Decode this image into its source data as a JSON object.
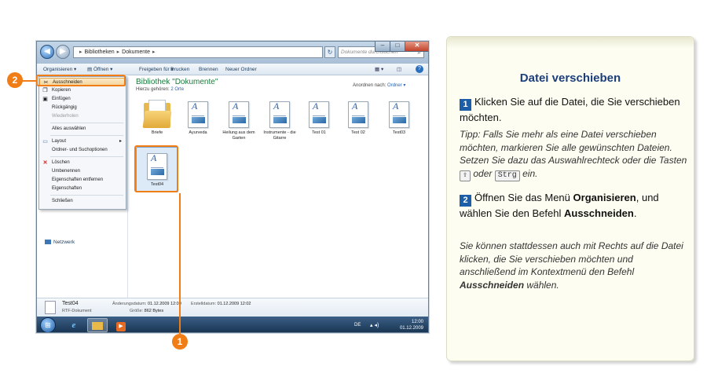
{
  "window": {
    "address": {
      "part1": "Bibliotheken",
      "part2": "Dokumente"
    },
    "search_placeholder": "Dokumente durchsuchen",
    "toolbar": {
      "organize": "Organisieren ▾",
      "open": "Öffnen ▾",
      "share": "Freigeben für ▾",
      "print": "Drucken",
      "burn": "Brennen",
      "new_folder": "Neuer Ordner"
    },
    "menu": {
      "items": [
        {
          "label": "Ausschneiden",
          "icon": "scissors-icon"
        },
        {
          "label": "Kopieren",
          "icon": "copy-icon"
        },
        {
          "label": "Einfügen",
          "icon": "paste-icon"
        },
        {
          "label": "Rückgängig",
          "icon": ""
        },
        {
          "label": "Wiederholen",
          "icon": ""
        },
        {
          "label": "Alles auswählen",
          "icon": ""
        },
        {
          "label": "Layout",
          "icon": "layout-icon"
        },
        {
          "label": "Ordner- und Suchoptionen",
          "icon": ""
        },
        {
          "label": "Löschen",
          "icon": "delete-icon"
        },
        {
          "label": "Umbenennen",
          "icon": ""
        },
        {
          "label": "Eigenschaften entfernen",
          "icon": ""
        },
        {
          "label": "Eigenschaften",
          "icon": ""
        },
        {
          "label": "Schließen",
          "icon": ""
        }
      ]
    },
    "nav": {
      "network": "Netzwerk"
    },
    "library": {
      "title": "Bibliothek \"Dokumente\"",
      "subtitle_prefix": "Hierzu gehören:",
      "subtitle_link": "2 Orte",
      "arrange_label": "Anordnen nach:",
      "arrange_value": "Ordner ▾"
    },
    "files": [
      {
        "name": "Briefe",
        "type": "folder"
      },
      {
        "name": "Ayurveda",
        "type": "doc"
      },
      {
        "name": "Heilung aus dem Garten",
        "type": "doc"
      },
      {
        "name": "Instrumente - die Gitarre",
        "type": "doc"
      },
      {
        "name": "Test 01",
        "type": "doc"
      },
      {
        "name": "Test 02",
        "type": "doc"
      },
      {
        "name": "Test03",
        "type": "doc"
      },
      {
        "name": "Test04",
        "type": "doc"
      }
    ],
    "details": {
      "name": "Test04",
      "type": "RTF-Dokument",
      "modified_label": "Änderungsdatum:",
      "modified_value": "01.12.2009 12:00",
      "size_label": "Größe:",
      "size_value": "862 Bytes",
      "created_label": "Erstelldatum:",
      "created_value": "01.12.2009 12:02"
    },
    "taskbar": {
      "lang": "DE",
      "time": "12:00",
      "date": "01.12.2009"
    }
  },
  "callouts": {
    "one": "1",
    "two": "2"
  },
  "panel": {
    "title": "Datei verschieben",
    "step1_num": "1",
    "step1_text": "Klicken Sie auf die Datei, die Sie verschieben möchten.",
    "tip_text": "Tipp: Falls Sie mehr als eine Datei verschieben möchten, markieren Sie alle gewünschten Dateien. Setzen Sie dazu das Auswahlrechteck oder die Tasten",
    "tip_key1": "⇧",
    "tip_or": "oder",
    "tip_key2": "Strg",
    "tip_end": "ein.",
    "step2_num": "2",
    "step2_text_a": "Öffnen Sie das Menü",
    "step2_bold_a": "Organisieren",
    "step2_text_b": ", und wählen Sie den Befehl",
    "step2_bold_b": "Ausschneiden",
    "step2_end": ".",
    "note_text": "Sie können stattdessen auch mit Rechts auf die Datei klicken, die Sie verschieben möchten und anschließend im Kontextmenü den Befehl",
    "note_bold": "Ausschneiden",
    "note_end": "wählen."
  },
  "colors": {
    "accent": "#f07d16",
    "title_blue": "#1c3f7c",
    "step_blue": "#1d5ea8"
  }
}
